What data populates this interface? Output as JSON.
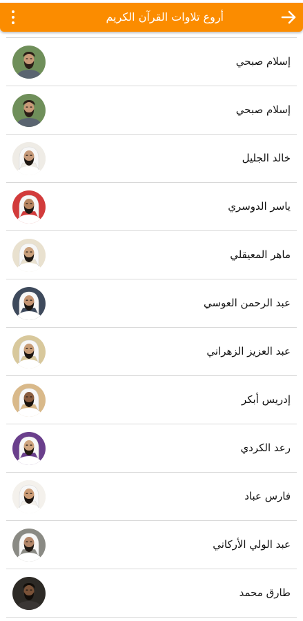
{
  "appbar": {
    "title": "أروع تلاوات القرآن الكريم",
    "background": "#fb8c00",
    "back_icon": "arrow-right-icon",
    "menu_icon": "more-vertical-icon"
  },
  "reciters": [
    {
      "name": "إسلام صبحي",
      "avatar_bg": "#6f8f5a",
      "shirt": "#5a6470",
      "skin": "#c99a78",
      "beard": "#2a1e16",
      "headwear": "none"
    },
    {
      "name": "إسلام صبحي",
      "avatar_bg": "#6f8f5a",
      "shirt": "#5a6470",
      "skin": "#c99a78",
      "beard": "#2a1e16",
      "headwear": "none"
    },
    {
      "name": "خالد الجليل",
      "avatar_bg": "#efece6",
      "shirt": "#ffffff",
      "skin": "#c69a7a",
      "beard": "#1d1712",
      "headwear": "white"
    },
    {
      "name": "ياسر الدوسري",
      "avatar_bg": "#d23b3b",
      "shirt": "#ffffff",
      "skin": "#b78560",
      "beard": "#1d1712",
      "headwear": "white"
    },
    {
      "name": "ماهر المعيقلي",
      "avatar_bg": "#e9e1cf",
      "shirt": "#ffffff",
      "skin": "#caa07c",
      "beard": "#1f1914",
      "headwear": "white"
    },
    {
      "name": "عبد الرحمن العوسي",
      "avatar_bg": "#3e4a5c",
      "shirt": "#ffffff",
      "skin": "#c49472",
      "beard": "#1b1510",
      "headwear": "white"
    },
    {
      "name": "عبد العزيز الزهراني",
      "avatar_bg": "#d8c89c",
      "shirt": "#ffffff",
      "skin": "#c79c77",
      "beard": "#1c1611",
      "headwear": "white"
    },
    {
      "name": "إدريس أبكر",
      "avatar_bg": "#d9b98a",
      "shirt": "#ffffff",
      "skin": "#8a5d3f",
      "beard": "#17110c",
      "headwear": "white"
    },
    {
      "name": "رعد الكردي",
      "avatar_bg": "#6a3f8c",
      "shirt": "#ffffff",
      "skin": "#cfa57f",
      "beard": "#20190f",
      "headwear": "white"
    },
    {
      "name": "فارس عباد",
      "avatar_bg": "#f4f1ec",
      "shirt": "#ffffff",
      "skin": "#cc9c76",
      "beard": "#1a1410",
      "headwear": "white"
    },
    {
      "name": "عبد الولي الأركاني",
      "avatar_bg": "#8a8a84",
      "shirt": "#ffffff",
      "skin": "#b4876a",
      "beard": "#201a15",
      "headwear": "white"
    },
    {
      "name": "طارق محمد",
      "avatar_bg": "#2d2a26",
      "shirt": "#3a3634",
      "skin": "#7a5238",
      "beard": "#120d09",
      "headwear": "none"
    }
  ]
}
